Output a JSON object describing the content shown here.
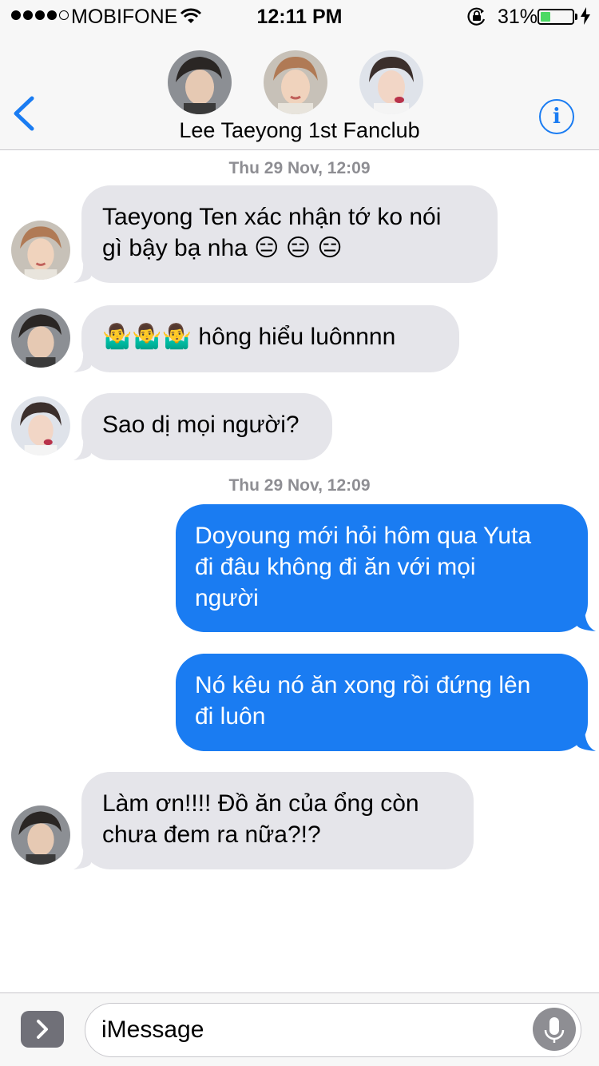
{
  "status_bar": {
    "carrier": "MOBIFONE",
    "time": "12:11 PM",
    "battery_percent": "31%",
    "battery_level": 0.31,
    "signal_bars": 4,
    "signal_max": 5
  },
  "header": {
    "group_name": "Lee Taeyong 1st Fanclub",
    "info_icon": "i"
  },
  "messages": [
    {
      "type": "timestamp",
      "date": "Thu 29 Nov,",
      "time": "12:09"
    },
    {
      "type": "in",
      "sender_avatar": "avatar-2",
      "text_lines": [
        "Taeyong Ten xác nhận tớ ko nói",
        "gì bậy bạ nha 😑 😑 😑"
      ]
    },
    {
      "type": "in",
      "sender_avatar": "avatar-1",
      "text_lines": [
        "🤷‍♂️🤷‍♂️🤷‍♂️  hông hiểu luônnnn"
      ]
    },
    {
      "type": "in",
      "sender_avatar": "avatar-3",
      "text_lines": [
        "Sao dị mọi người?"
      ]
    },
    {
      "type": "timestamp",
      "date": "Thu 29 Nov,",
      "time": "12:09"
    },
    {
      "type": "out",
      "text_lines": [
        "Doyoung mới hỏi hôm qua Yuta",
        "đi đâu không đi ăn với mọi",
        "người"
      ]
    },
    {
      "type": "out",
      "text_lines": [
        "Nó kêu nó ăn xong rồi đứng lên",
        "đi luôn"
      ]
    },
    {
      "type": "in",
      "sender_avatar": "avatar-1",
      "text_lines": [
        "Làm ơn!!!! Đồ ăn của ổng còn",
        "chưa đem ra nữa?!?"
      ]
    }
  ],
  "input": {
    "placeholder": "iMessage"
  },
  "colors": {
    "accent": "#1a7cf2",
    "incoming_bubble": "#e5e5ea",
    "outgoing_bubble": "#1a7cf2",
    "battery": "#4cd964"
  }
}
